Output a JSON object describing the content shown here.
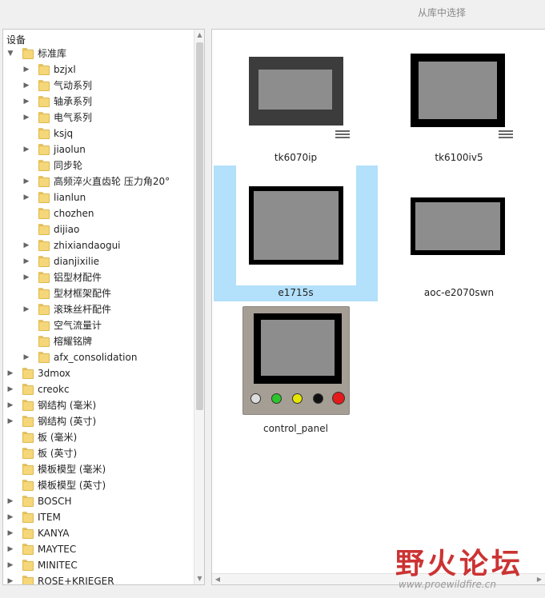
{
  "window": {
    "title": "从库中选择"
  },
  "tree": {
    "root_label": "设备",
    "items": [
      {
        "label": "标准库",
        "level": 0,
        "toggle": "expanded"
      },
      {
        "label": "bzjxl",
        "level": 1,
        "toggle": "collapsed"
      },
      {
        "label": "气动系列",
        "level": 1,
        "toggle": "collapsed"
      },
      {
        "label": "轴承系列",
        "level": 1,
        "toggle": "collapsed"
      },
      {
        "label": "电气系列",
        "level": 1,
        "toggle": "collapsed"
      },
      {
        "label": "ksjq",
        "level": 1,
        "toggle": "none"
      },
      {
        "label": "jiaolun",
        "level": 1,
        "toggle": "collapsed"
      },
      {
        "label": "同步轮",
        "level": 1,
        "toggle": "none"
      },
      {
        "label": "高频淬火直齿轮 压力角20°",
        "level": 1,
        "toggle": "collapsed"
      },
      {
        "label": "lianlun",
        "level": 1,
        "toggle": "collapsed"
      },
      {
        "label": "chozhen",
        "level": 1,
        "toggle": "none"
      },
      {
        "label": "dijiao",
        "level": 1,
        "toggle": "none"
      },
      {
        "label": "zhixiandaogui",
        "level": 1,
        "toggle": "collapsed"
      },
      {
        "label": "dianjixilie",
        "level": 1,
        "toggle": "collapsed"
      },
      {
        "label": "铝型材配件",
        "level": 1,
        "toggle": "collapsed"
      },
      {
        "label": "型材框架配件",
        "level": 1,
        "toggle": "none"
      },
      {
        "label": "滚珠丝杆配件",
        "level": 1,
        "toggle": "collapsed"
      },
      {
        "label": "空气流量计",
        "level": 1,
        "toggle": "none"
      },
      {
        "label": "榕耀铭牌",
        "level": 1,
        "toggle": "none"
      },
      {
        "label": "afx_consolidation",
        "level": 1,
        "toggle": "collapsed"
      },
      {
        "label": "3dmox",
        "level": 0,
        "toggle": "collapsed"
      },
      {
        "label": "creokc",
        "level": 0,
        "toggle": "collapsed"
      },
      {
        "label": "钢结构 (毫米)",
        "level": 0,
        "toggle": "collapsed"
      },
      {
        "label": "钢结构 (英寸)",
        "level": 0,
        "toggle": "collapsed"
      },
      {
        "label": "板 (毫米)",
        "level": 0,
        "toggle": "none"
      },
      {
        "label": "板 (英寸)",
        "level": 0,
        "toggle": "none"
      },
      {
        "label": "模板模型 (毫米)",
        "level": 0,
        "toggle": "none"
      },
      {
        "label": "模板模型 (英寸)",
        "level": 0,
        "toggle": "none"
      },
      {
        "label": "BOSCH",
        "level": 0,
        "toggle": "collapsed"
      },
      {
        "label": "ITEM",
        "level": 0,
        "toggle": "collapsed"
      },
      {
        "label": "KANYA",
        "level": 0,
        "toggle": "collapsed"
      },
      {
        "label": "MAYTEC",
        "level": 0,
        "toggle": "collapsed"
      },
      {
        "label": "MINITEC",
        "level": 0,
        "toggle": "collapsed"
      },
      {
        "label": "ROSE+KRIEGER",
        "level": 0,
        "toggle": "collapsed"
      }
    ]
  },
  "preview": {
    "items": [
      {
        "name": "tk6070ip",
        "selected": false,
        "has_list_icon": true
      },
      {
        "name": "tk6100iv5",
        "selected": false,
        "has_list_icon": true
      },
      {
        "name": "e1715s",
        "selected": true,
        "has_list_icon": false
      },
      {
        "name": "aoc-e2070swn",
        "selected": false,
        "has_list_icon": false
      },
      {
        "name": "control_panel",
        "selected": false,
        "has_list_icon": false
      }
    ]
  },
  "watermark": {
    "text": "野火论坛",
    "url": "www.proewildfire.cn"
  },
  "colors": {
    "selection": "#b3e0fb",
    "folder": "#f5d77a",
    "screen": "#8d8d8d",
    "watermark": "#cc3333"
  }
}
